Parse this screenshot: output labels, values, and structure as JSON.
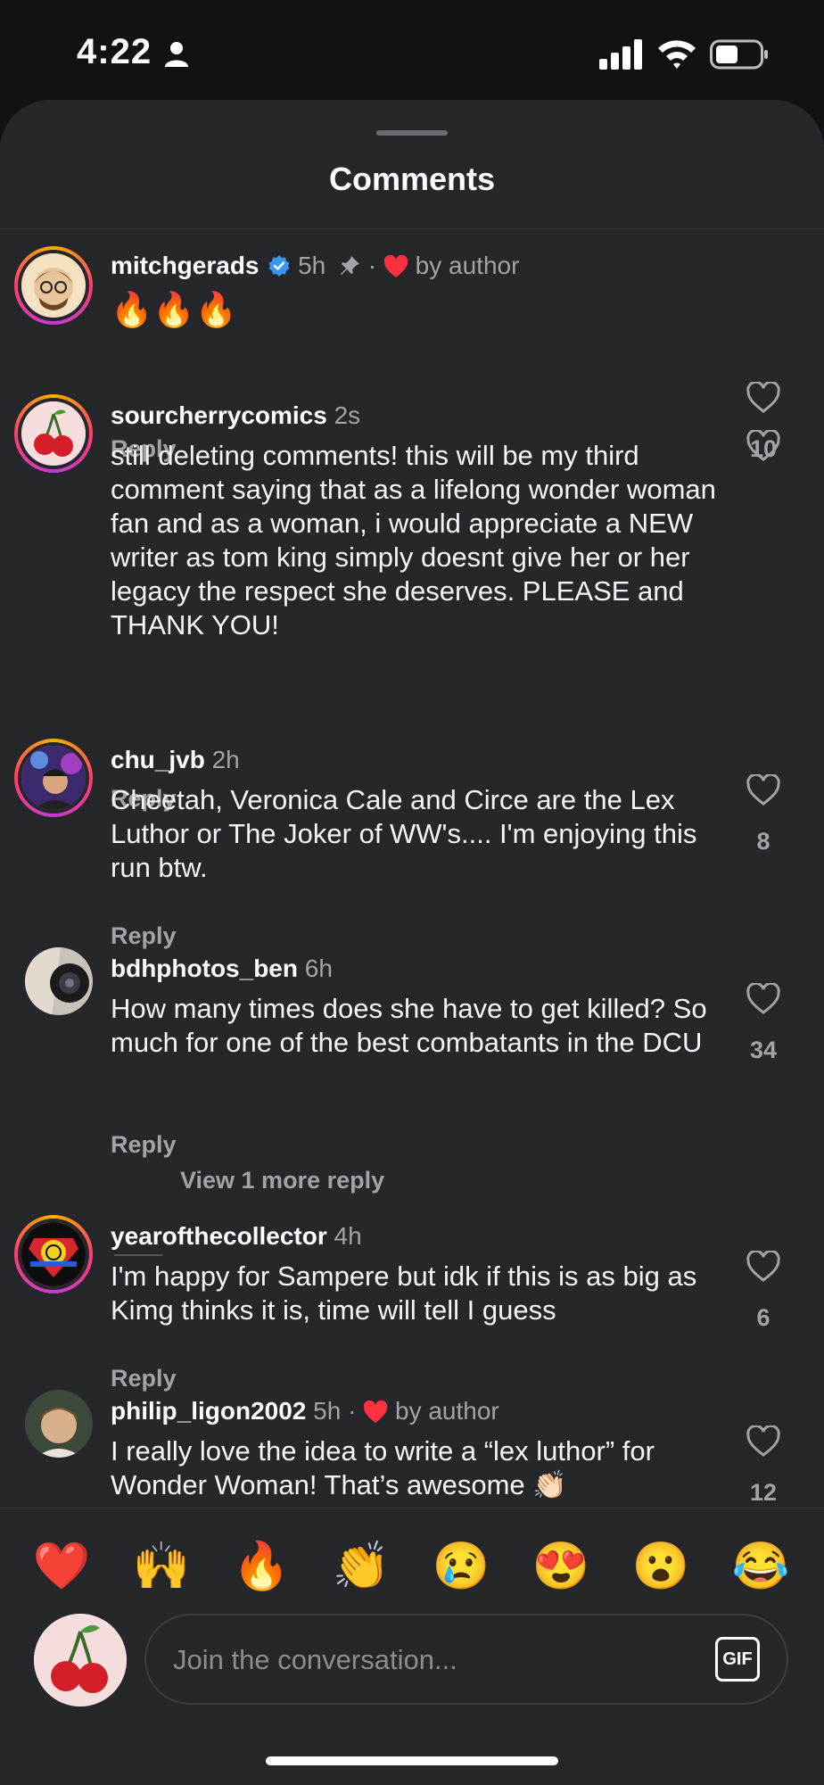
{
  "status": {
    "time": "4:22"
  },
  "header": {
    "title": "Comments"
  },
  "comments": [
    {
      "username": "mitchgerads",
      "time": "5h",
      "verified": true,
      "pinned": true,
      "by_author_label": "by author",
      "text": "🔥🔥🔥",
      "reply_label": "Reply",
      "likes": "10"
    },
    {
      "username": "sourcherrycomics",
      "time": "2s",
      "text": "still deleting comments! this will be my third comment saying that as a lifelong wonder woman fan and as a woman, i would appreciate a NEW writer as tom king simply doesnt give her or her legacy the respect she deserves. PLEASE and THANK YOU!",
      "reply_label": "Reply",
      "likes": ""
    },
    {
      "username": "chu_jvb",
      "time": "2h",
      "text": "Cheetah, Veronica Cale and Circe are the Lex Luthor or The Joker of WW's.... I'm enjoying this run btw.",
      "reply_label": "Reply",
      "likes": "8"
    },
    {
      "username": "bdhphotos_ben",
      "time": "6h",
      "text": "How many times does she have to get killed? So much for one of the best combatants in the DCU",
      "reply_label": "Reply",
      "likes": "34",
      "view_more": "View 1 more reply"
    },
    {
      "username": "yearofthecollector",
      "time": "4h",
      "text": "I'm happy for Sampere but idk if this is as big as Kimg thinks it is, time will tell I guess",
      "reply_label": "Reply",
      "likes": "6"
    },
    {
      "username": "philip_ligon2002",
      "time": "5h",
      "by_author_label": "by author",
      "text": "I really love the idea to write a “lex luthor” for Wonder Woman! That’s awesome 👏🏻",
      "likes": "12"
    }
  ],
  "reactions": [
    "❤️",
    "🙌",
    "🔥",
    "👏",
    "😢",
    "😍",
    "😮",
    "😂"
  ],
  "composer": {
    "placeholder": "Join the conversation...",
    "gif_label": "GIF"
  },
  "colors": {
    "sheet": "#26272b",
    "background": "#121212",
    "heart": "#ff3040",
    "verified": "#3897f0"
  }
}
